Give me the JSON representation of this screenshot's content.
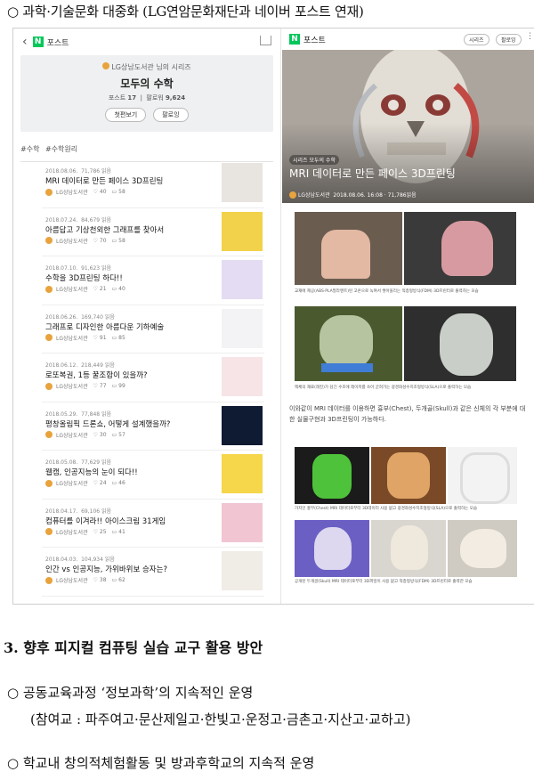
{
  "doc": {
    "line1": "○  과학·기술문화 대중화 (LG연암문화재단과 네이버 포스트 연재)",
    "heading3": "3. 향후 피지컬 컴퓨팅 실습 교구 활용 방안",
    "line3": "○  공동교육과정 ‘정보과학’의 지속적인 운영",
    "line4": "(참여교 : 파주여고·문산제일고·한빛고·운정고·금촌고·지산고·교하고)",
    "line5": "○  학교내 창의적체험활동 및 방과후학교의 지속적 운영"
  },
  "left": {
    "top_label": "포스트",
    "series_by": "LG상남도서관 님의 시리즈",
    "series_title": "모두의 수학",
    "posts_label": "포스트",
    "posts_count": "17",
    "followers_label": "팔로워",
    "followers_count": "9,624",
    "first_btn": "첫편보기",
    "follow_btn": "팔로잉",
    "tags": [
      "#수학",
      "#수학원리"
    ],
    "posts": [
      {
        "date": "2018.08.06.",
        "views": "71,786 읽음",
        "title": "MRI 데이터로 만든 페이스 3D프린팅",
        "author": "LG상남도서관",
        "likes": "40",
        "comments": "58"
      },
      {
        "date": "2018.07.24.",
        "views": "84,679 읽음",
        "title": "아름답고 기상천외한 그래프를 찾아서",
        "author": "LG상남도서관",
        "likes": "70",
        "comments": "58"
      },
      {
        "date": "2018.07.10.",
        "views": "91,623 읽음",
        "title": "수학을 3D프린팅 하다!!",
        "author": "LG상남도서관",
        "likes": "21",
        "comments": "40"
      },
      {
        "date": "2018.06.26.",
        "views": "169,740 읽음",
        "title": "그래프로 디자인한 아름다운 기하예술",
        "author": "LG상남도서관",
        "likes": "91",
        "comments": "85"
      },
      {
        "date": "2018.06.12.",
        "views": "218,449 읽음",
        "title": "로또복권, 1등 꿀조합이 있을까?",
        "author": "LG상남도서관",
        "likes": "77",
        "comments": "99"
      },
      {
        "date": "2018.05.29.",
        "views": "77,848 읽음",
        "title": "평창올림픽 드론쇼, 어떻게 설계했을까?",
        "author": "LG상남도서관",
        "likes": "30",
        "comments": "57"
      },
      {
        "date": "2018.05.08.",
        "views": "77,629 읽음",
        "title": "웹캠, 인공지능의 눈이 되다!!",
        "author": "LG상남도서관",
        "likes": "24",
        "comments": "46"
      },
      {
        "date": "2018.04.17.",
        "views": "69,106 읽음",
        "title": "컴퓨터를 이겨라!! 아이스크림 31게임",
        "author": "LG상남도서관",
        "likes": "25",
        "comments": "41"
      },
      {
        "date": "2018.04.03.",
        "views": "104,934 읽음",
        "title": "인간 vs 인공지능, 가위바위보 승자는?",
        "author": "LG상남도서관",
        "likes": "38",
        "comments": "62"
      }
    ]
  },
  "right": {
    "top_label": "포스트",
    "series_pill": "시리즈",
    "follow_pill": "팔로잉",
    "hero_badge": "시리즈 모두의 수학",
    "hero_title": "MRI 데이터로 만든 페이스 3D프린팅",
    "hero_author": "LG상남도서관",
    "hero_meta": "2018.08.06. 16:08 · 71,786읽음",
    "caption1": "교재에 제공(ABS·PLA필라멘트)된 고온으로 녹여서 쌓아올리는 적층형방식(FDM) 3D프린터로 출력하는 모습",
    "caption2": "액체의 재료(레진)가 담긴 수조에 레이저를 쏘아 굳혀가는 광경화성수지조형방식(SLA)으로 출력하는 모습",
    "body_text": "이와같이 MRI 데이터를 이용하면 흉부(Chest), 두개골(Skull)과 같은 신체의 각 부분에 대한 실물구현과 3D프린팅이 가능하다.",
    "caption3": "가지인 흉부(Chest) MRI 데이터로부터 3D데이터 사용 없고 광경화성수지조형방식(SLA)으로 출력하는 모습",
    "caption4": "공개된 두개골(Skull) MRI 데이터로부터 3D파일이 사용 없고 적층형방식(FDM) 3D프린터로 출력한 모습"
  }
}
